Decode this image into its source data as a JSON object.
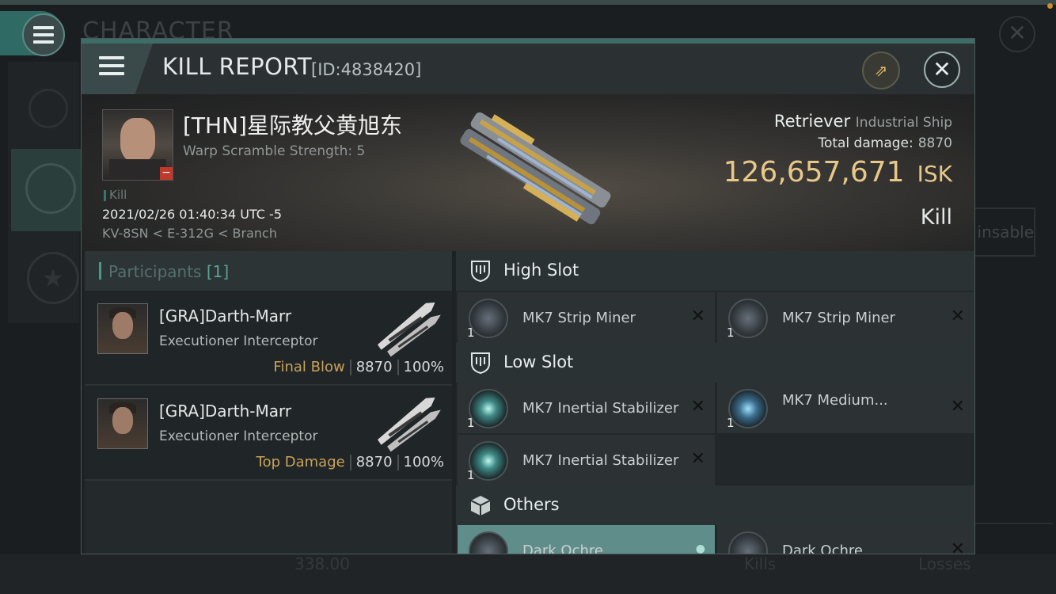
{
  "background": {
    "title": "CHARACTER",
    "right_box_label": "insable",
    "bottom_value": "338.00",
    "bottom_kills": "Kills",
    "bottom_losses": "Losses"
  },
  "header": {
    "title": "KILL REPORT",
    "id": "[ID:4838420]"
  },
  "victim": {
    "name": "[THN]星际教父黄旭东",
    "warp_scramble": "Warp Scramble Strength: 5",
    "kill_tag": "Kill",
    "datetime": "2021/02/26 01:40:34 UTC -5",
    "location": "KV-8SN < E-312G < Branch",
    "ship_name": "Retriever",
    "ship_class": "Industrial Ship",
    "total_damage_label": "Total damage:",
    "total_damage": "8870",
    "isk_value": "126,657,671",
    "isk_unit": "ISK",
    "result": "Kill"
  },
  "participants": {
    "label": "Participants",
    "count": "[1]",
    "rows": [
      {
        "name": "[GRA]Darth-Marr",
        "ship": "Executioner Interceptor",
        "role": "Final Blow",
        "damage": "8870",
        "percent": "100%"
      },
      {
        "name": "[GRA]Darth-Marr",
        "ship": "Executioner Interceptor",
        "role": "Top Damage",
        "damage": "8870",
        "percent": "100%"
      }
    ]
  },
  "fitting": {
    "high_slot": {
      "label": "High Slot",
      "items": [
        {
          "name": "MK7 Strip Miner",
          "qty": "1"
        },
        {
          "name": "MK7 Strip Miner",
          "qty": "1"
        }
      ]
    },
    "low_slot": {
      "label": "Low Slot",
      "items": [
        {
          "name": "MK7 Inertial Stabilizer",
          "qty": "1"
        },
        {
          "name": "MK7 Medium...",
          "qty": "1"
        },
        {
          "name": "MK7 Inertial Stabilizer",
          "qty": "1"
        }
      ]
    },
    "others": {
      "label": "Others",
      "items": [
        {
          "name": "Dark Ochre",
          "qty": ""
        },
        {
          "name": "Dark Ochre",
          "qty": ""
        }
      ]
    }
  },
  "colors": {
    "accent": "#3e6c66",
    "isk": "#e8c888",
    "role": "#c9a25a",
    "selected_item": "#5f8e8a"
  }
}
